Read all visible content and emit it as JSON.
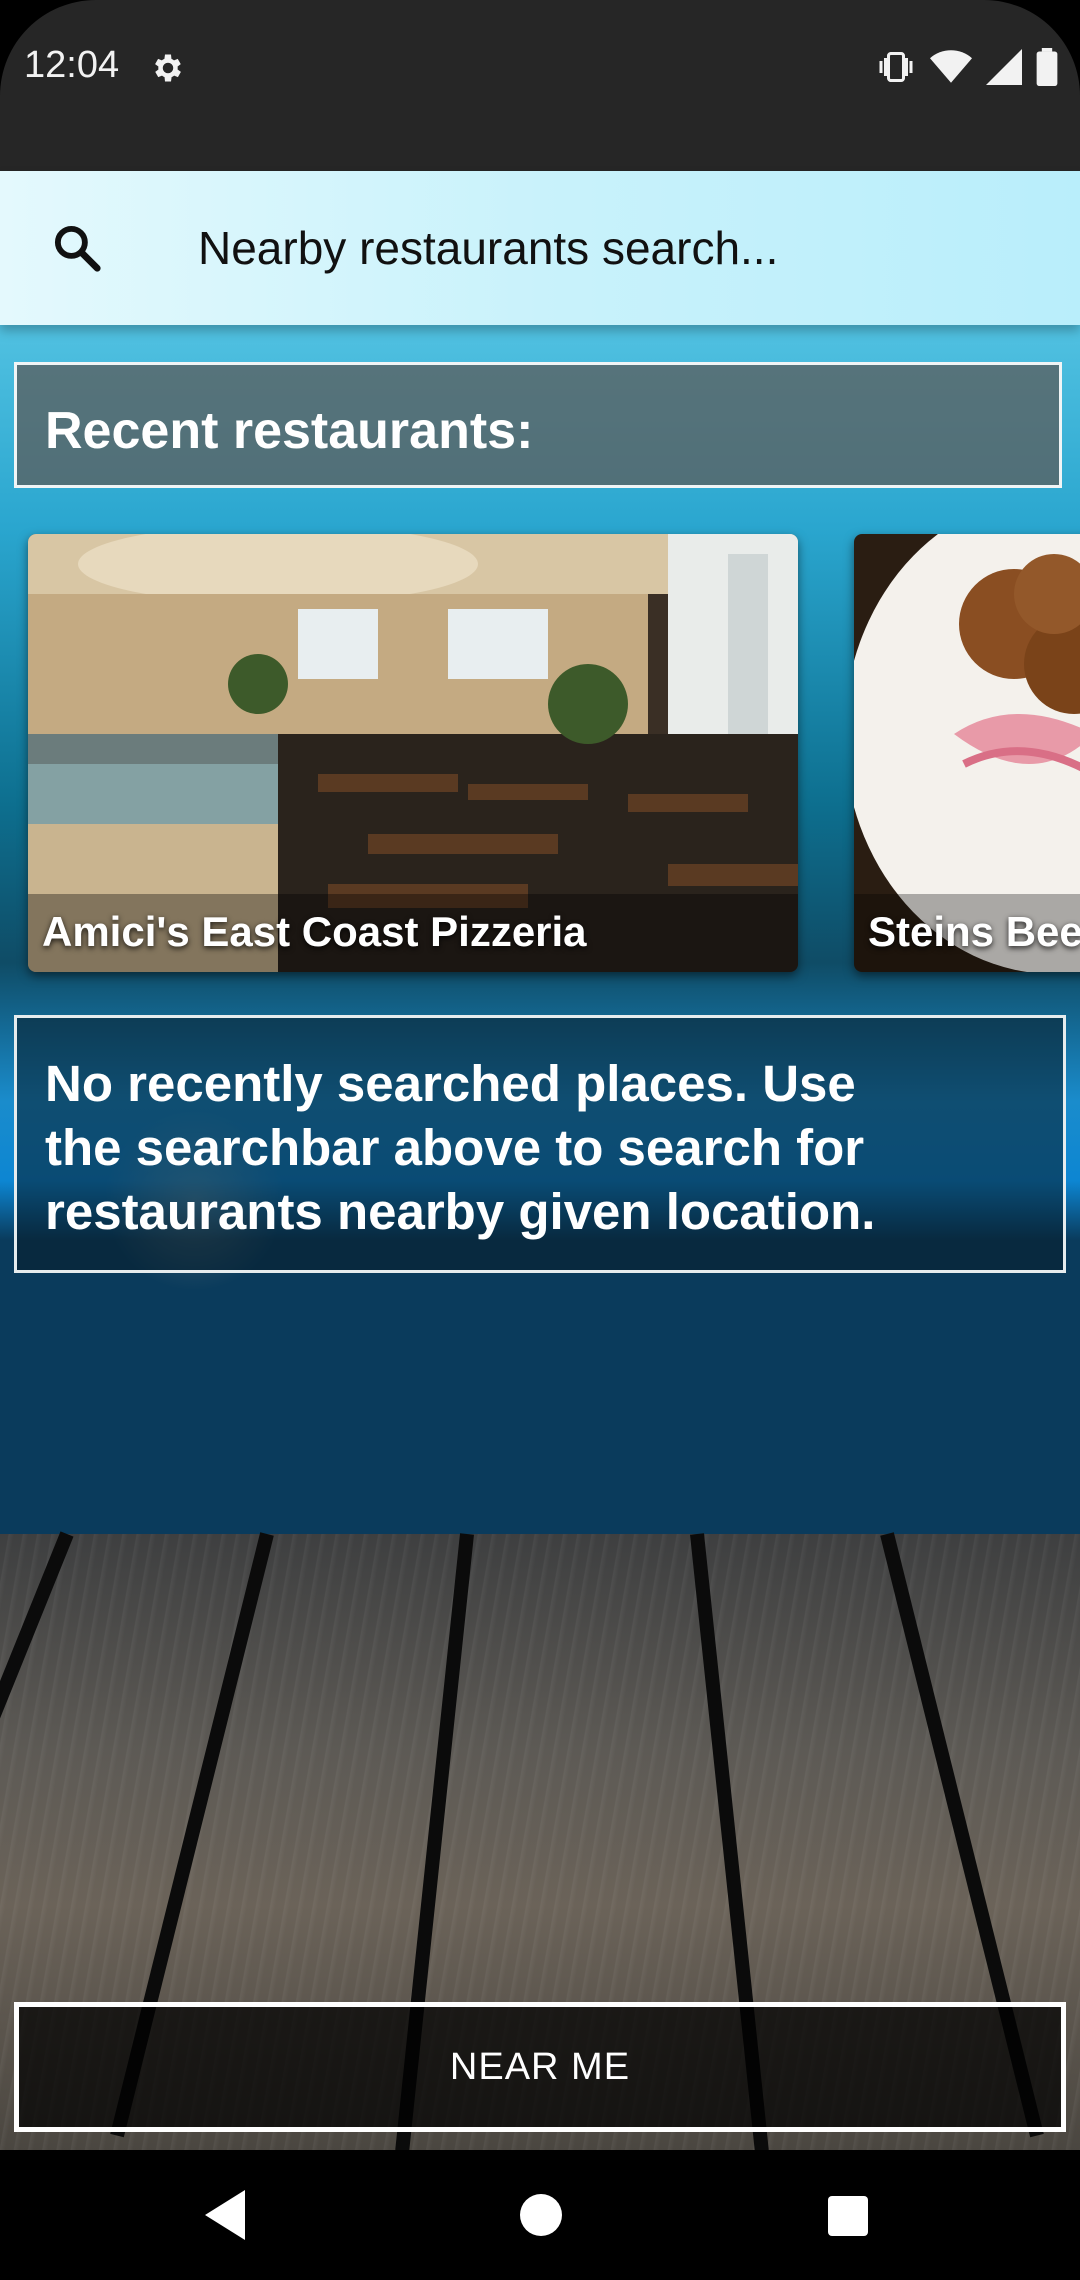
{
  "status_bar": {
    "time": "12:04",
    "icons": [
      "settings-gear-icon",
      "vibrate-icon",
      "wifi-icon",
      "cell-signal-icon",
      "battery-icon"
    ]
  },
  "search": {
    "icon": "search-icon",
    "placeholder": "Nearby restaurants search..."
  },
  "recent": {
    "header": "Recent restaurants:",
    "items": [
      {
        "name": "Amici's East Coast Pizzeria"
      },
      {
        "name": "Steins Bee"
      }
    ]
  },
  "empty_message": "No recently searched places. Use the searchbar above to search for restaurants nearby given location.",
  "near_me": {
    "label": "NEAR ME"
  },
  "nav_bar": {
    "icons": [
      "back-icon",
      "home-icon",
      "recents-icon"
    ]
  },
  "colors": {
    "status_bar": "#262626",
    "search_bar": "#c9f2fb",
    "overlay_text": "#ffffff"
  }
}
